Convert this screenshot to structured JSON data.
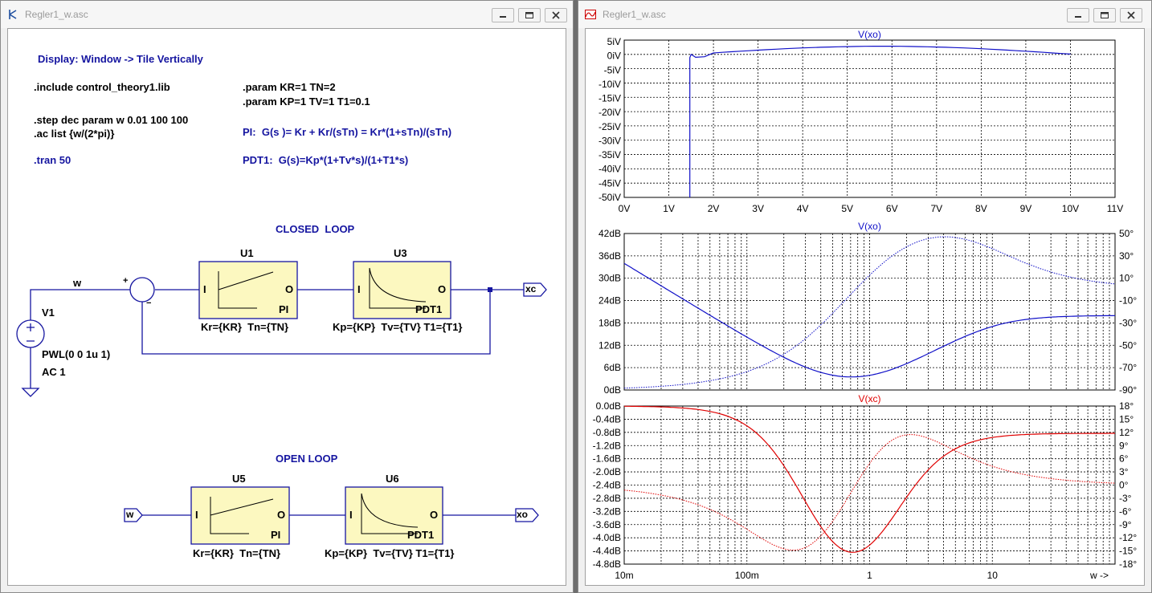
{
  "left_window": {
    "title": "Regler1_w.asc",
    "directives": {
      "display": "Display: Window -> Tile Vertically",
      "include": ".include control_theory1.lib",
      "step": ".step dec param w 0.01 100 100",
      "ac": ".ac list {w/(2*pi)}",
      "tran": ".tran 50",
      "param1": ".param KR=1 TN=2",
      "param2": ".param KP=1 TV=1 T1=0.1",
      "pi_eq": "PI:  G(s )= Kr + Kr/(sTn) = Kr*(1+sTn)/(sTn)",
      "pdt1_eq": "PDT1:  G(s)=Kp*(1+Tv*s)/(1+T1*s)"
    },
    "closed_loop": {
      "heading": "CLOSED  LOOP",
      "wire_label_w": "w",
      "source_name": "V1",
      "source_value": "PWL(0 0 1u 1)",
      "source_ac": "AC 1",
      "sum_plus": "+",
      "sum_minus": "−",
      "u1": {
        "name": "U1",
        "in": "I",
        "out": "O",
        "type": "PI",
        "params": "Kr={KR}  Tn={TN}"
      },
      "u3": {
        "name": "U3",
        "in": "I",
        "out": "O",
        "type": "PDT1",
        "params": "Kp={KP}  Tv={TV} T1={T1}"
      },
      "out_label": "xc"
    },
    "open_loop": {
      "heading": "OPEN LOOP",
      "in_label": "w",
      "u5": {
        "name": "U5",
        "in": "I",
        "out": "O",
        "type": "PI",
        "params": "Kr={KR}  Tn={TN}"
      },
      "u6": {
        "name": "U6",
        "in": "I",
        "out": "O",
        "type": "PDT1",
        "params": "Kp={KP}  Tv={TV} T1={T1}"
      },
      "out_label": "xo"
    }
  },
  "right_window": {
    "title": "Regler1_w.asc",
    "plot1": {
      "trace": "V(xo)",
      "y_ticks": [
        "5iV",
        "0iV",
        "-5iV",
        "-10iV",
        "-15iV",
        "-20iV",
        "-25iV",
        "-30iV",
        "-35iV",
        "-40iV",
        "-45iV",
        "-50iV"
      ],
      "x_ticks": [
        "0V",
        "1V",
        "2V",
        "3V",
        "4V",
        "5V",
        "6V",
        "7V",
        "8V",
        "9V",
        "10V",
        "11V"
      ]
    },
    "plot2": {
      "trace": "V(xo)",
      "y_ticks": [
        "42dB",
        "36dB",
        "30dB",
        "24dB",
        "18dB",
        "12dB",
        "6dB",
        "0dB"
      ],
      "y2_ticks": [
        "50°",
        "30°",
        "10°",
        "-10°",
        "-30°",
        "-50°",
        "-70°",
        "-90°"
      ]
    },
    "plot3": {
      "trace": "V(xc)",
      "y_ticks": [
        "0.0dB",
        "-0.4dB",
        "-0.8dB",
        "-1.2dB",
        "-1.6dB",
        "-2.0dB",
        "-2.4dB",
        "-2.8dB",
        "-3.2dB",
        "-3.6dB",
        "-4.0dB",
        "-4.4dB",
        "-4.8dB"
      ],
      "y2_ticks": [
        "18°",
        "15°",
        "12°",
        "9°",
        "6°",
        "3°",
        "0°",
        "-3°",
        "-6°",
        "-9°",
        "-12°",
        "-15°",
        "-18°"
      ],
      "x_ticks": [
        "10m",
        "100m",
        "1",
        "10"
      ],
      "x_axis_label": "w ->"
    },
    "colors": {
      "trace_blue": "#1010c8",
      "trace_red": "#e00000"
    }
  }
}
